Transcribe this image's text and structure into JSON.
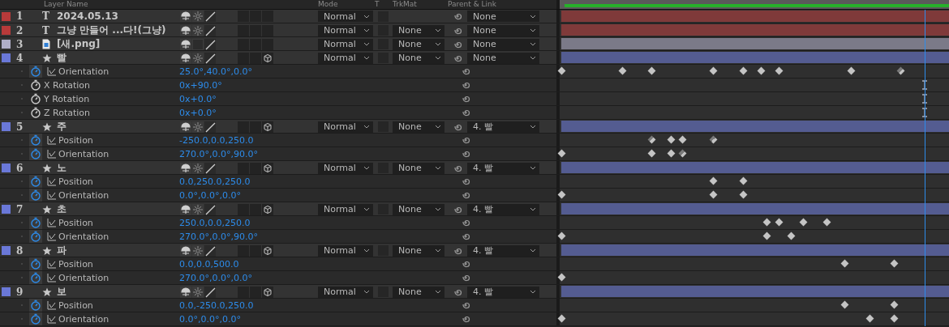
{
  "header": {
    "columns": [
      "Layer Name",
      "Mode",
      "T",
      "TrkMat",
      "Parent & Link"
    ]
  },
  "playhead": {
    "level": 0.937
  },
  "layers": [
    {
      "number": "1",
      "name": "2024.05.13",
      "kind": "text",
      "glyph": "T",
      "color": "#b83a3a",
      "collapse": true,
      "three_d": false,
      "mode": "Normal",
      "preserve_transparency": false,
      "parent": "None"
    },
    {
      "number": "2",
      "name": "그냥 만들어 ...다!(그냥)",
      "kind": "text",
      "glyph": "T",
      "color": "#b83a3a",
      "collapse": true,
      "three_d": false,
      "mode": "Normal",
      "preserve_transparency": false,
      "trkmat": "None",
      "parent": "None"
    },
    {
      "number": "3",
      "name": "[새.png]",
      "kind": "footage",
      "color": "#b0aec8",
      "collapse": false,
      "three_d": false,
      "mode": "Normal",
      "preserve_transparency": false,
      "trkmat": "None",
      "parent": "None"
    },
    {
      "number": "4",
      "name": "빨",
      "kind": "shape",
      "color": "#6a78d8",
      "collapse": true,
      "three_d": true,
      "mode": "Normal",
      "preserve_transparency": false,
      "trkmat": "None",
      "parent": "None",
      "properties": [
        {
          "name": "Orientation",
          "animated": true,
          "value": "25.0°,40.0°,0.0°",
          "keyframes": [
            {
              "kind": "linear",
              "level": 0.006
            },
            {
              "kind": "linear",
              "level": 0.163
            },
            {
              "kind": "linear",
              "level": 0.238
            },
            {
              "kind": "linear",
              "level": 0.395
            },
            {
              "kind": "linear",
              "level": 0.473
            },
            {
              "kind": "linear",
              "level": 0.519
            },
            {
              "kind": "linear",
              "level": 0.565
            },
            {
              "kind": "linear",
              "level": 0.751
            },
            {
              "kind": "ease",
              "level": 0.877
            }
          ]
        },
        {
          "name": "X Rotation",
          "animated": false,
          "value": "0x+90.0°",
          "keyframes": [
            {
              "kind": "hold",
              "level": 0.937
            }
          ]
        },
        {
          "name": "Y Rotation",
          "animated": false,
          "value": "0x+0.0°",
          "keyframes": [
            {
              "kind": "hold",
              "level": 0.937
            }
          ]
        },
        {
          "name": "Z Rotation",
          "animated": false,
          "value": "0x+0.0°",
          "keyframes": [
            {
              "kind": "hold",
              "level": 0.937
            }
          ]
        }
      ]
    },
    {
      "number": "5",
      "name": "주",
      "kind": "shape",
      "color": "#6a78d8",
      "collapse": true,
      "three_d": true,
      "mode": "Normal",
      "preserve_transparency": false,
      "trkmat": "None",
      "parent": "4. 빨",
      "properties": [
        {
          "name": "Position",
          "animated": true,
          "value": "-250.0,0.0,250.0",
          "keyframes": [
            {
              "kind": "ease",
              "level": 0.238
            },
            {
              "kind": "linear",
              "level": 0.287
            },
            {
              "kind": "linear",
              "level": 0.316
            },
            {
              "kind": "ease",
              "level": 0.395
            }
          ]
        },
        {
          "name": "Orientation",
          "animated": true,
          "value": "270.0°,0.0°,90.0°",
          "keyframes": [
            {
              "kind": "linear",
              "level": 0.006
            },
            {
              "kind": "linear",
              "level": 0.238
            },
            {
              "kind": "linear",
              "level": 0.287
            },
            {
              "kind": "ease",
              "level": 0.316
            }
          ]
        }
      ]
    },
    {
      "number": "6",
      "name": "노",
      "kind": "shape",
      "color": "#6a78d8",
      "collapse": true,
      "three_d": true,
      "mode": "Normal",
      "preserve_transparency": false,
      "trkmat": "None",
      "parent": "4. 빨",
      "properties": [
        {
          "name": "Position",
          "animated": true,
          "value": "0.0,250.0,250.0",
          "keyframes": [
            {
              "kind": "linear",
              "level": 0.395
            },
            {
              "kind": "linear",
              "level": 0.473
            }
          ]
        },
        {
          "name": "Orientation",
          "animated": true,
          "value": "0.0°,0.0°,0.0°",
          "keyframes": [
            {
              "kind": "linear",
              "level": 0.006
            },
            {
              "kind": "linear",
              "level": 0.395
            },
            {
              "kind": "linear",
              "level": 0.473
            }
          ]
        }
      ]
    },
    {
      "number": "7",
      "name": "초",
      "kind": "shape",
      "color": "#6a78d8",
      "collapse": true,
      "three_d": true,
      "mode": "Normal",
      "preserve_transparency": false,
      "trkmat": "None",
      "parent": "4. 빨",
      "properties": [
        {
          "name": "Position",
          "animated": true,
          "value": "250.0,0.0,250.0",
          "keyframes": [
            {
              "kind": "linear",
              "level": 0.533
            },
            {
              "kind": "linear",
              "level": 0.565
            },
            {
              "kind": "linear",
              "level": 0.628
            },
            {
              "kind": "linear",
              "level": 0.688
            }
          ]
        },
        {
          "name": "Orientation",
          "animated": true,
          "value": "270.0°,0.0°,90.0°",
          "keyframes": [
            {
              "kind": "linear",
              "level": 0.006
            },
            {
              "kind": "linear",
              "level": 0.533
            },
            {
              "kind": "linear",
              "level": 0.596
            }
          ]
        }
      ]
    },
    {
      "number": "8",
      "name": "파",
      "kind": "shape",
      "color": "#6a78d8",
      "collapse": true,
      "three_d": true,
      "mode": "Normal",
      "preserve_transparency": false,
      "trkmat": "None",
      "parent": "4. 빨",
      "properties": [
        {
          "name": "Position",
          "animated": true,
          "value": "0.0,0.0,500.0",
          "keyframes": [
            {
              "kind": "linear",
              "level": 0.734
            },
            {
              "kind": "linear",
              "level": 0.86
            }
          ]
        },
        {
          "name": "Orientation",
          "animated": true,
          "value": "270.0°,0.0°,0.0°",
          "keyframes": [
            {
              "kind": "linear",
              "level": 0.006
            }
          ]
        }
      ]
    },
    {
      "number": "9",
      "name": "보",
      "kind": "shape",
      "color": "#6a78d8",
      "collapse": true,
      "three_d": true,
      "mode": "Normal",
      "preserve_transparency": false,
      "trkmat": "None",
      "parent": "4. 빨",
      "properties": [
        {
          "name": "Position",
          "animated": true,
          "value": "0.0,-250.0,250.0",
          "keyframes": [
            {
              "kind": "linear",
              "level": 0.734
            },
            {
              "kind": "linear",
              "level": 0.86
            }
          ]
        },
        {
          "name": "Orientation",
          "animated": true,
          "value": "0.0°,0.0°,0.0°",
          "keyframes": [
            {
              "kind": "linear",
              "level": 0.006
            },
            {
              "kind": "linear",
              "level": 0.797
            },
            {
              "kind": "linear",
              "level": 0.86
            }
          ]
        }
      ]
    }
  ]
}
